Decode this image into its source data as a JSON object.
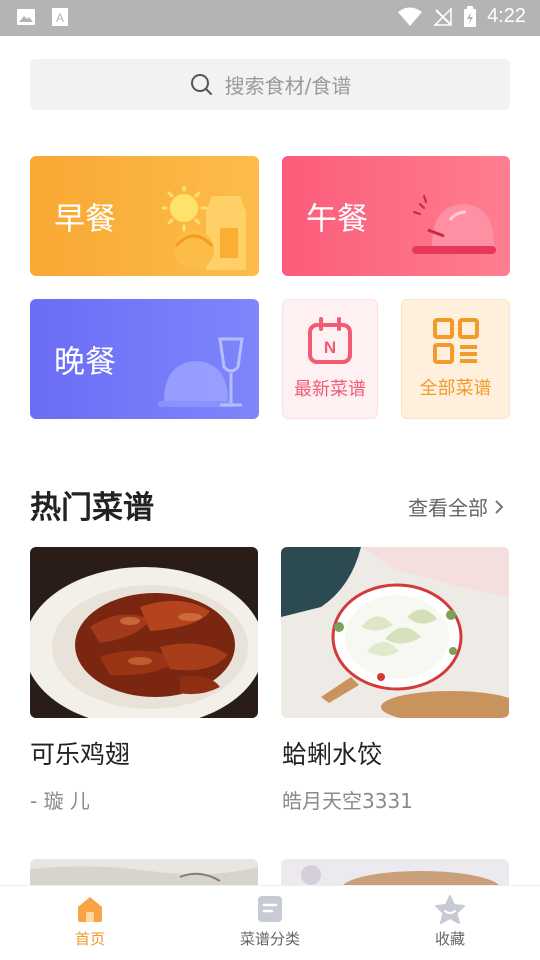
{
  "status_bar": {
    "time": "4:22"
  },
  "search": {
    "placeholder": "搜索食材/食谱"
  },
  "meals": {
    "breakfast": "早餐",
    "lunch": "午餐",
    "dinner": "晚餐"
  },
  "tiles": {
    "newest": "最新菜谱",
    "all": "全部菜谱"
  },
  "hot_section": {
    "title": "热门菜谱",
    "view_all": "查看全部"
  },
  "recipes": [
    {
      "title": "可乐鸡翅",
      "author": "- 璇 儿"
    },
    {
      "title": "蛤蜊水饺",
      "author": "皓月天空3331"
    }
  ],
  "bottom_nav": [
    {
      "label": "首页",
      "icon": "home-icon",
      "active": true
    },
    {
      "label": "菜谱分类",
      "icon": "category-icon",
      "active": false
    },
    {
      "label": "收藏",
      "icon": "star-icon",
      "active": false
    }
  ],
  "colors": {
    "accent": "#f39a2a",
    "breakfast": "#f8a833",
    "lunch": "#fb5c7a",
    "dinner": "#6a6cf6"
  }
}
